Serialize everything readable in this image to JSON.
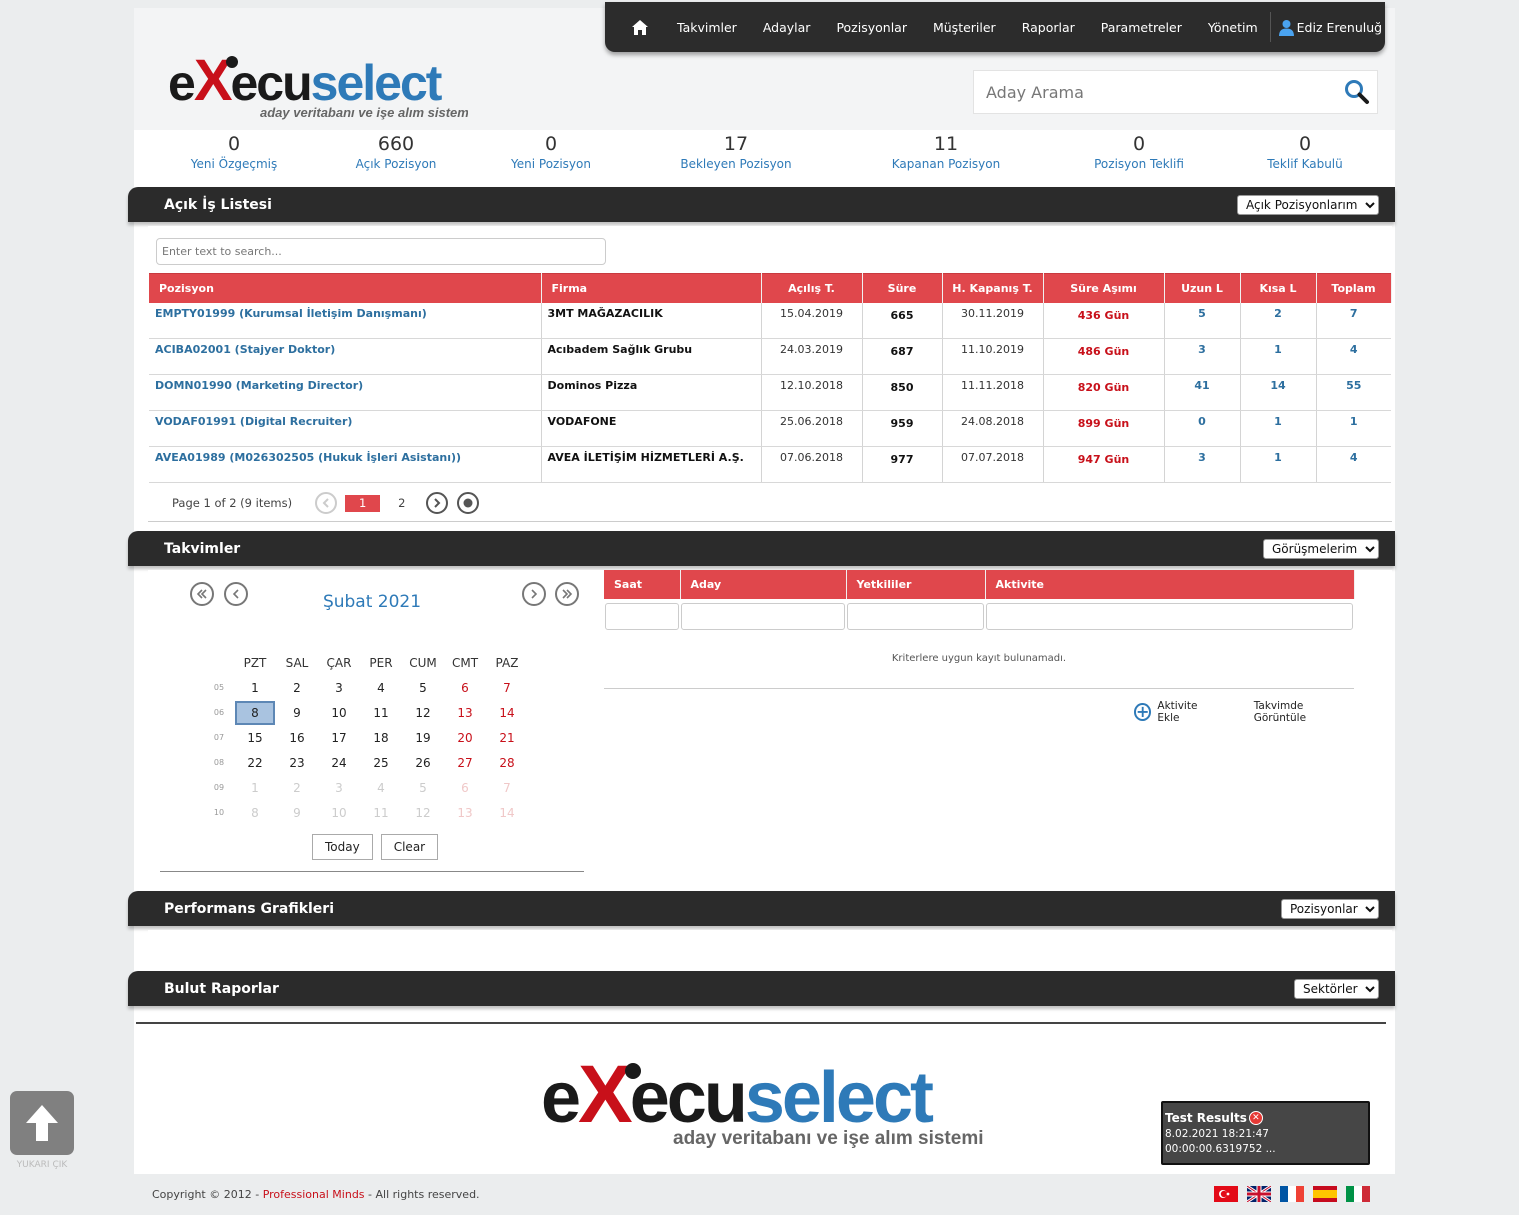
{
  "nav": {
    "items": [
      "Takvimler",
      "Adaylar",
      "Pozisyonlar",
      "Müşteriler",
      "Raporlar",
      "Parametreler",
      "Yönetim"
    ],
    "user": "Ediz Erenuluğ"
  },
  "logo": {
    "main_dark": "e",
    "x": "X",
    "dark2": "ecu",
    "blue": "select",
    "tagline": "aday veritabanı ve işe alım sistemi"
  },
  "search": {
    "placeholder": "Aday Arama"
  },
  "stats": [
    {
      "value": "0",
      "label": "Yeni Özgeçmiş"
    },
    {
      "value": "660",
      "label": "Açık Pozisyon"
    },
    {
      "value": "0",
      "label": "Yeni Pozisyon"
    },
    {
      "value": "17",
      "label": "Bekleyen Pozisyon"
    },
    {
      "value": "11",
      "label": "Kapanan Pozisyon"
    },
    {
      "value": "0",
      "label": "Pozisyon Teklifi"
    },
    {
      "value": "0",
      "label": "Teklif Kabulü"
    }
  ],
  "jobs": {
    "title": "Açık İş Listesi",
    "filter": "Açık Pozisyonlarım",
    "search_placeholder": "Enter text to search...",
    "columns": [
      "Pozisyon",
      "Firma",
      "Açılış T.",
      "Süre",
      "H. Kapanış T.",
      "Süre Aşımı",
      "Uzun L",
      "Kısa L",
      "Toplam"
    ],
    "rows": [
      [
        "EMPTY01999 (Kurumsal İletişim Danışmanı)",
        "3MT MAĞAZACILIK",
        "15.04.2019",
        "665",
        "30.11.2019",
        "436 Gün",
        "5",
        "2",
        "7"
      ],
      [
        "ACIBA02001 (Stajyer Doktor)",
        "Acıbadem Sağlık Grubu",
        "24.03.2019",
        "687",
        "11.10.2019",
        "486 Gün",
        "3",
        "1",
        "4"
      ],
      [
        "DOMN01990 (Marketing Director)",
        "Dominos Pizza",
        "12.10.2018",
        "850",
        "11.11.2018",
        "820 Gün",
        "41",
        "14",
        "55"
      ],
      [
        "VODAF01991 (Digital Recruiter)",
        "VODAFONE",
        "25.06.2018",
        "959",
        "24.08.2018",
        "899 Gün",
        "0",
        "1",
        "1"
      ],
      [
        "AVEA01989 (M026302505 (Hukuk İşleri Asistanı))",
        "AVEA İLETİŞİM HİZMETLERİ A.Ş.",
        "07.06.2018",
        "977",
        "07.07.2018",
        "947 Gün",
        "3",
        "1",
        "4"
      ]
    ],
    "pager": {
      "summary": "Page 1 of 2 (9 items)",
      "current": "1",
      "next": "2"
    }
  },
  "calendar": {
    "title": "Takvimler",
    "filter": "Görüşmelerim",
    "month": "Şubat 2021",
    "weekdays": [
      "PZT",
      "SAL",
      "ÇAR",
      "PER",
      "CUM",
      "CMT",
      "PAZ"
    ],
    "weeks": [
      {
        "wk": "05",
        "days": [
          "1",
          "2",
          "3",
          "4",
          "5",
          "6",
          "7"
        ]
      },
      {
        "wk": "06",
        "days": [
          "8",
          "9",
          "10",
          "11",
          "12",
          "13",
          "14"
        ]
      },
      {
        "wk": "07",
        "days": [
          "15",
          "16",
          "17",
          "18",
          "19",
          "20",
          "21"
        ]
      },
      {
        "wk": "08",
        "days": [
          "22",
          "23",
          "24",
          "25",
          "26",
          "27",
          "28"
        ]
      },
      {
        "wk": "09",
        "days": [
          "1",
          "2",
          "3",
          "4",
          "5",
          "6",
          "7"
        ]
      },
      {
        "wk": "10",
        "days": [
          "8",
          "9",
          "10",
          "11",
          "12",
          "13",
          "14"
        ]
      }
    ],
    "today_label": "Today",
    "clear_label": "Clear",
    "agenda_columns": [
      "Saat",
      "Aday",
      "Yetkililer",
      "Aktivite"
    ],
    "no_records": "Kriterlere uygun kayıt bulunamadı.",
    "add_activity": "Aktivite Ekle",
    "view_calendar": "Takvimde Görüntüle"
  },
  "performance": {
    "title": "Performans Grafikleri",
    "filter": "Pozisyonlar"
  },
  "cloud": {
    "title": "Bulut Raporlar",
    "filter": "Sektörler"
  },
  "test_results": {
    "title": "Test Results",
    "date": "8.02.2021 18:21:47",
    "duration": "00:00:00.6319752 ..."
  },
  "scroll_top": {
    "label": "YUKARI ÇIK"
  },
  "footer": {
    "copyright_pre": "Copyright © 2012 - ",
    "company": "Professional Minds",
    "copyright_post": " - All rights reserved."
  },
  "colors": {
    "accent_red": "#e0474c",
    "link_blue": "#2e7ab8",
    "dark_bar": "#2b2b2b"
  }
}
